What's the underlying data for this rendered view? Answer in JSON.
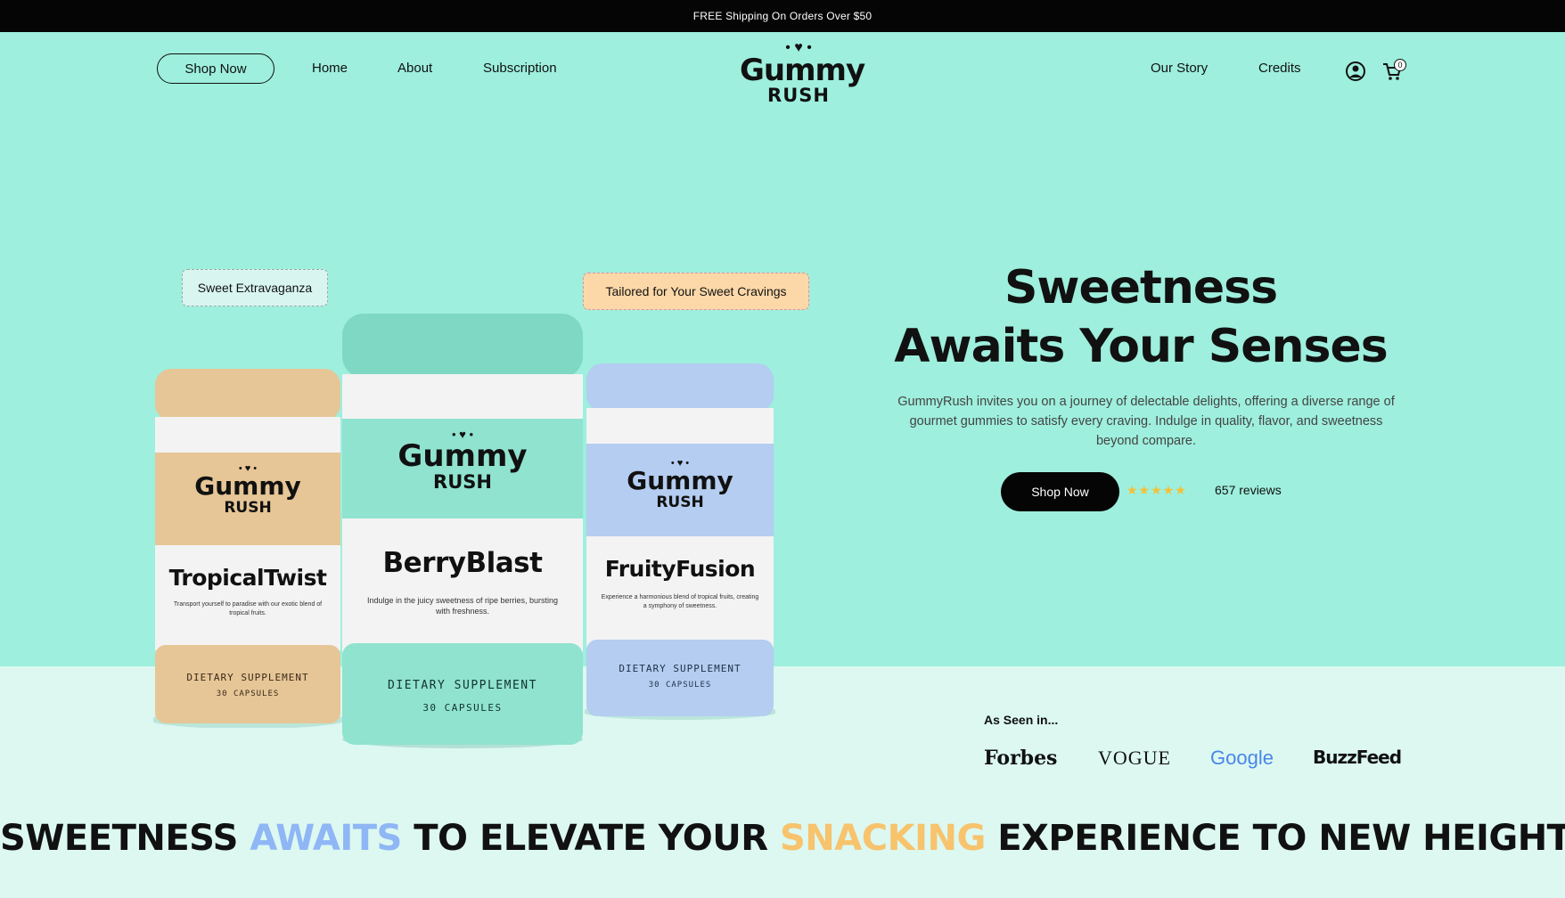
{
  "announcement": "FREE Shipping On Orders Over $50",
  "nav": {
    "shop_now": "Shop Now",
    "links": [
      "Home",
      "About",
      "Subscription",
      "Our Story",
      "Credits"
    ],
    "cart_count": "0"
  },
  "logo": {
    "line1": "Gummy",
    "line2": "RUSH"
  },
  "tags": {
    "left": "Sweet Extravaganza",
    "right": "Tailored for Your Sweet Cravings"
  },
  "jars": [
    {
      "name": "TropicalTwist",
      "desc": "Transport yourself to paradise with our exotic blend of tropical fruits.",
      "supplement": "DIETARY SUPPLEMENT",
      "capsules": "30 CAPSULES"
    },
    {
      "name": "BerryBlast",
      "desc": "Indulge in the juicy sweetness of ripe berries, bursting with freshness.",
      "supplement": "DIETARY SUPPLEMENT",
      "capsules": "30 CAPSULES"
    },
    {
      "name": "FruityFusion",
      "desc": "Experience a harmonious blend of tropical fruits, creating a symphony of sweetness.",
      "supplement": "DIETARY SUPPLEMENT",
      "capsules": "30 CAPSULES"
    }
  ],
  "hero": {
    "title_line1": "Sweetness",
    "title_line2": "Awaits Your Senses",
    "description": "GummyRush invites you on a journey of delectable delights, offering a diverse range of gourmet gummies to satisfy every craving. Indulge in quality, flavor, and sweetness beyond compare.",
    "shop_now": "Shop Now",
    "stars": "★★★★★",
    "reviews": "657 reviews"
  },
  "press": {
    "heading": "As Seen in...",
    "brands": [
      "Forbes",
      "VOGUE",
      "Google",
      "BuzzFeed"
    ]
  },
  "tagline": {
    "part1": "SWEETNESS ",
    "part2": "AWAITS",
    "part3": " TO ELEVATE YOUR ",
    "part4": "SNACKING",
    "part5": " EXPERIENCE TO NEW HEIGHTS"
  },
  "colors": {
    "background": "#9eefdd",
    "lower_background": "#dcf8f1",
    "accent_blue": "#8fb6f5",
    "accent_orange": "#f7c36d",
    "star": "#f6bf33"
  }
}
